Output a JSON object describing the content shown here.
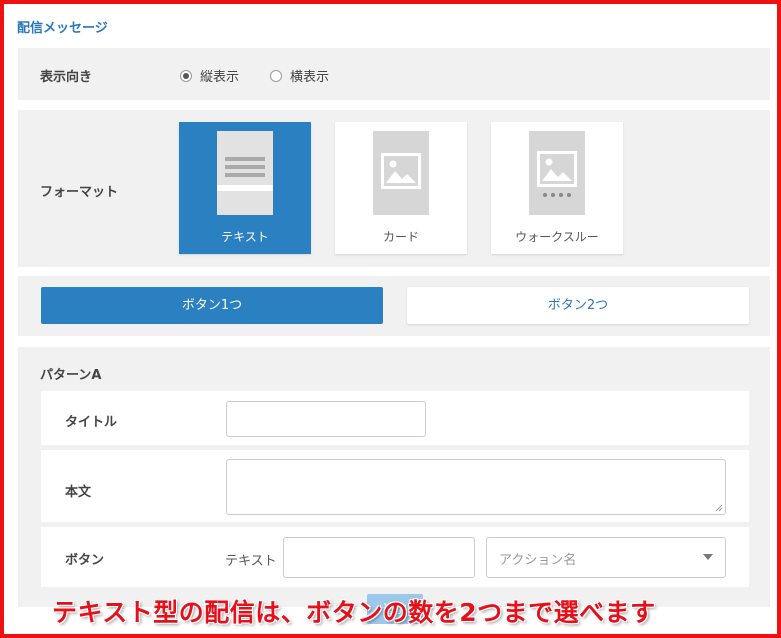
{
  "page_title": "配信メッセージ",
  "orientation": {
    "label": "表示向き",
    "options": [
      "縦表示",
      "横表示"
    ],
    "selected": "縦表示"
  },
  "format": {
    "label": "フォーマット",
    "options": [
      {
        "label": "テキスト",
        "icon": "text-layout-icon",
        "selected": true
      },
      {
        "label": "カード",
        "icon": "image-card-icon",
        "selected": false
      },
      {
        "label": "ウォークスルー",
        "icon": "carousel-icon",
        "selected": false
      }
    ]
  },
  "button_count": {
    "options": [
      "ボタン1つ",
      "ボタン2つ"
    ],
    "selected": "ボタン1つ"
  },
  "pattern": {
    "title": "パターンA",
    "title_field_label": "タイトル",
    "body_field_label": "本文",
    "button_field_label": "ボタン",
    "button_text_label": "テキスト",
    "action_placeholder": "アクション名",
    "add_button_label": "追加"
  },
  "annotation": "テキスト型の配信は、ボタンの数を2つまで選べます",
  "colors": {
    "accent": "#2b80c2",
    "annotation_red": "#e4101a",
    "frame_red": "#ee1111"
  }
}
